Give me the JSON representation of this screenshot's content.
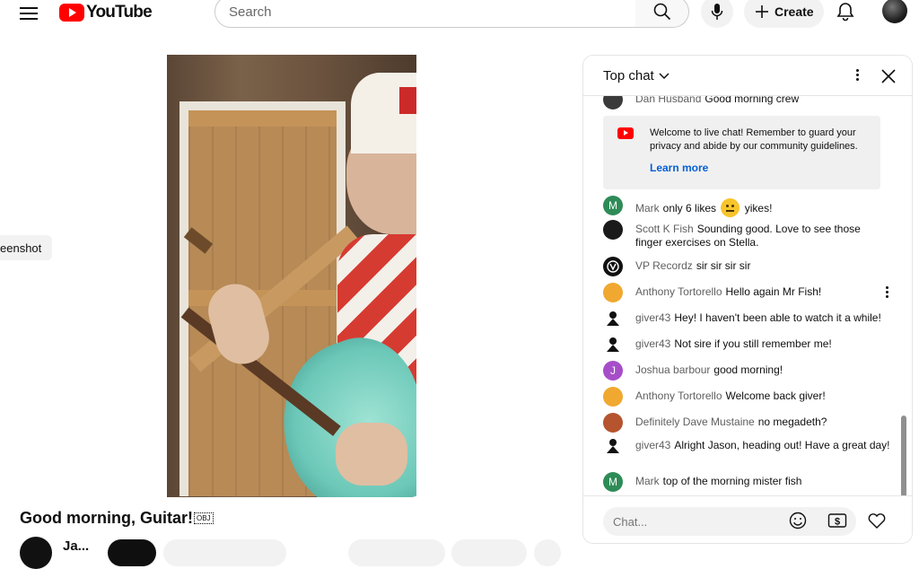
{
  "header": {
    "logo_text": "YouTube",
    "search_placeholder": "Search",
    "create_label": "Create"
  },
  "sidebar_pill": {
    "label": "eenshot"
  },
  "video": {
    "title": "Good morning, Guitar!",
    "title_badge": "OBJ",
    "channel_name": "Ja..."
  },
  "chat": {
    "title": "Top chat",
    "welcome": {
      "text": "Welcome to live chat! Remember to guard your privacy and abide by our community guidelines.",
      "link": "Learn more"
    },
    "messages": [
      {
        "author": "Dan Husband",
        "text": "Good morning crew",
        "avatar_color": "#3a3a3a",
        "avatar_letter": ""
      },
      {
        "author": "Mark",
        "text": "only 6 likes",
        "text_after": "yikes!",
        "emoji": "neutral-face-icon",
        "avatar_color": "#2e8b57",
        "avatar_letter": "M"
      },
      {
        "author": "Scott K Fish",
        "text": "Sounding good. Love to see those finger exercises on Stella.",
        "avatar_color": "#1a1a1a",
        "avatar_letter": ""
      },
      {
        "author": "VP Recordz",
        "text": "sir sir sir sir",
        "avatar_color": "#111111",
        "avatar_letter": ""
      },
      {
        "author": "Anthony Tortorello",
        "text": "Hello again Mr Fish!",
        "avatar_color": "#f0a830",
        "avatar_letter": ""
      },
      {
        "author": "giver43",
        "text": "Hey! I haven't been able to watch it a while!",
        "avatar_color": "#ffffff",
        "avatar_letter": ""
      },
      {
        "author": "giver43",
        "text": "Not sire if you still remember me!",
        "avatar_color": "#ffffff",
        "avatar_letter": ""
      },
      {
        "author": "Joshua barbour",
        "text": "good morning!",
        "avatar_color": "#a64ec9",
        "avatar_letter": "J"
      },
      {
        "author": "Anthony Tortorello",
        "text": "Welcome back giver!",
        "avatar_color": "#f0a830",
        "avatar_letter": ""
      },
      {
        "author": "Definitely Dave Mustaine",
        "text": "no megadeth?",
        "avatar_color": "#b5542e",
        "avatar_letter": ""
      },
      {
        "author": "giver43",
        "text": "Alright Jason, heading out! Have a great day!",
        "avatar_color": "#ffffff",
        "avatar_letter": ""
      },
      {
        "author": "Mark",
        "text": "top of the morning mister fish",
        "avatar_color": "#2e8b57",
        "avatar_letter": "M"
      }
    ],
    "input_placeholder": "Chat..."
  },
  "colors": {
    "brand_red": "#ff0000",
    "link_blue": "#065fd4",
    "author_gray": "#606060"
  }
}
